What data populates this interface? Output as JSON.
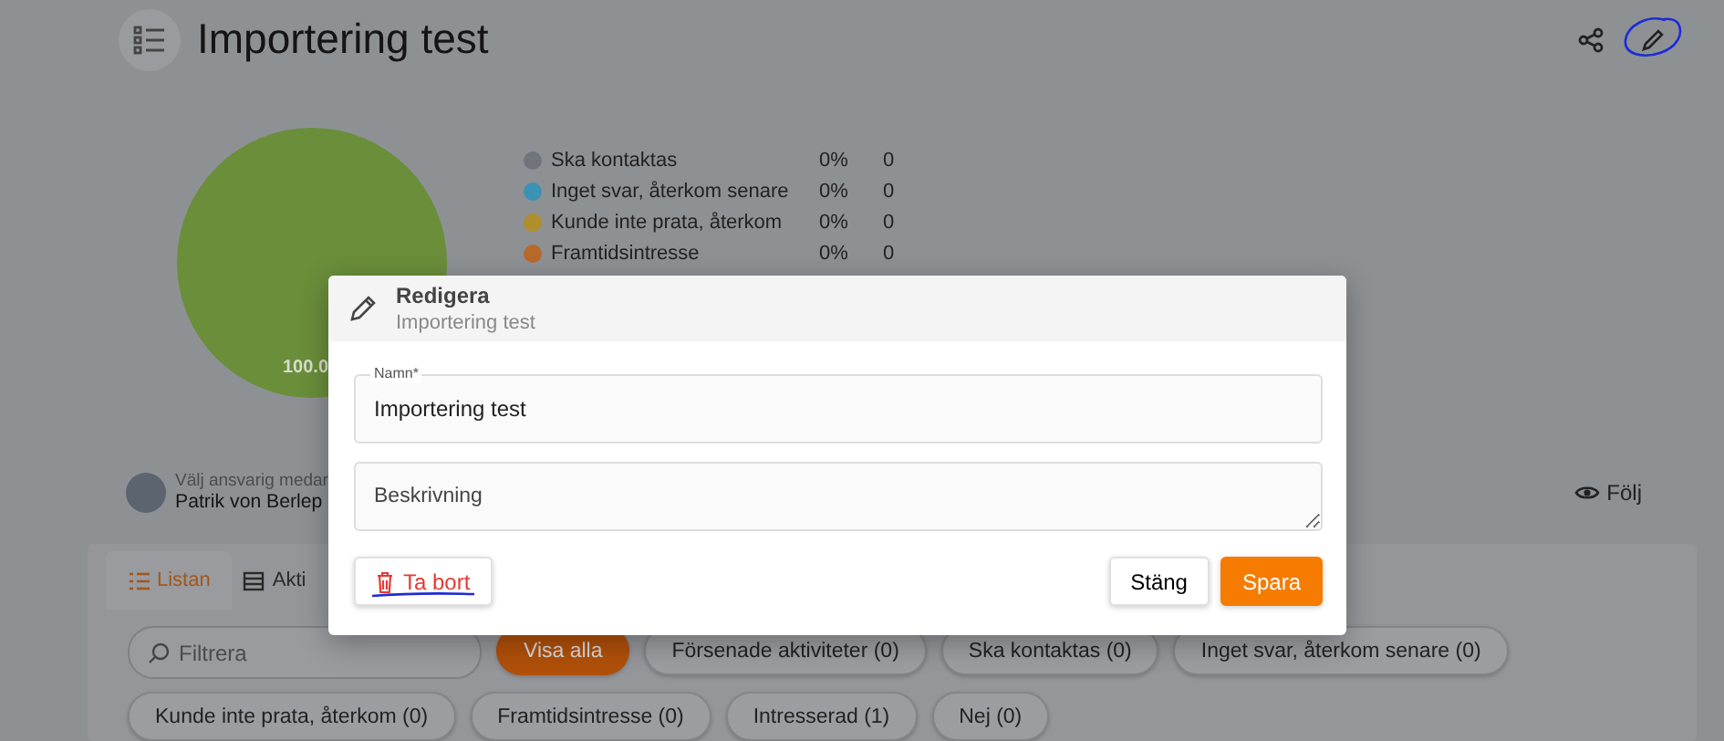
{
  "header": {
    "title": "Importering test"
  },
  "chart": {
    "slice_label": "100.0"
  },
  "legend": [
    {
      "name": "Ska kontaktas",
      "color": "#6f747d",
      "percent": "0%",
      "count": "0"
    },
    {
      "name": "Inget svar, återkom senare",
      "color": "#3b92b6",
      "percent": "0%",
      "count": "0"
    },
    {
      "name": "Kunde inte prata, återkom",
      "color": "#b08e2c",
      "percent": "0%",
      "count": "0"
    },
    {
      "name": "Framtidsintresse",
      "color": "#b86a2a",
      "percent": "0%",
      "count": "0"
    }
  ],
  "owner": {
    "label": "Välj ansvarig medar",
    "name": "Patrik von Berlep"
  },
  "follow": {
    "label": "Följ"
  },
  "tabs": [
    {
      "label": "Listan",
      "selected": true
    },
    {
      "label": "Akti",
      "selected": false
    }
  ],
  "filter": {
    "placeholder": "Filtrera"
  },
  "chips": [
    {
      "label": "Visa alla",
      "selected": true
    },
    {
      "label": "Försenade aktiviteter (0)",
      "selected": false
    },
    {
      "label": "Ska kontaktas (0)",
      "selected": false
    },
    {
      "label": "Inget svar, återkom senare (0)",
      "selected": false
    },
    {
      "label": "Kunde inte prata, återkom (0)",
      "selected": false
    },
    {
      "label": "Framtidsintresse (0)",
      "selected": false
    },
    {
      "label": "Intresserad (1)",
      "selected": false
    },
    {
      "label": "Nej (0)",
      "selected": false
    }
  ],
  "dialog": {
    "title": "Redigera",
    "subtitle": "Importering test",
    "fields": [
      {
        "kind": "input",
        "label": "Namn*",
        "value": "Importering test"
      },
      {
        "kind": "textarea",
        "placeholder": "Beskrivning"
      }
    ],
    "buttons": [
      {
        "kind": "delete",
        "label": "Ta bort"
      },
      {
        "kind": "secondary",
        "label": "Stäng"
      },
      {
        "kind": "primary",
        "label": "Spara"
      }
    ]
  }
}
